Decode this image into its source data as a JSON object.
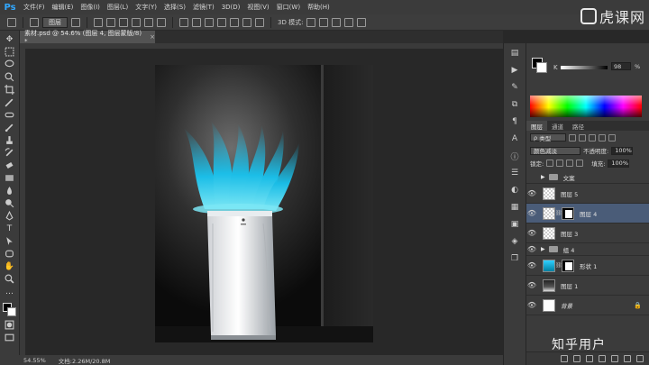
{
  "app": {
    "logo": "Ps",
    "menu": [
      "文件(F)",
      "编辑(E)",
      "图像(I)",
      "图层(L)",
      "文字(Y)",
      "选择(S)",
      "滤镜(T)",
      "3D(D)",
      "视图(V)",
      "窗口(W)",
      "帮助(H)"
    ]
  },
  "watermark_top": {
    "brand": "虎课网"
  },
  "watermark_bottom": {
    "text": "知乎用户"
  },
  "options_bar": {
    "auto_select_value": "图层",
    "mode_3d_label": "3D 模式:"
  },
  "document": {
    "tab_title": "素材.psd @ 54.6% (图层 4, 图层蒙版/8) *",
    "close_glyph": "×"
  },
  "status_bar": {
    "zoom": "54.55%",
    "doc_size": "文档:2.26M/20.8M"
  },
  "color_panel": {
    "channel_label": "K",
    "k_value": "98",
    "k_unit": "%"
  },
  "layers_panel": {
    "tabs": [
      "图层",
      "通道",
      "路径"
    ],
    "filter_kind": "类型",
    "blend_mode": "颜色减淡",
    "opacity_label": "不透明度:",
    "opacity_value": "100%",
    "lock_label": "锁定:",
    "fill_label": "填充:",
    "fill_value": "100%",
    "layers": [
      {
        "name": "文案",
        "kind": "group",
        "visible": false
      },
      {
        "name": "图层 5",
        "kind": "pixel",
        "visible": true
      },
      {
        "name": "图层 4",
        "kind": "masked",
        "visible": true,
        "selected": true
      },
      {
        "name": "图层 3",
        "kind": "pixel",
        "visible": true
      },
      {
        "name": "组 4",
        "kind": "group",
        "visible": true
      },
      {
        "name": "形状 1",
        "kind": "shape",
        "visible": true
      },
      {
        "name": "图层 1",
        "kind": "photo",
        "visible": true
      },
      {
        "name": "背景",
        "kind": "background",
        "visible": true,
        "locked": true
      }
    ]
  },
  "colors": {
    "accent_blue": "#31a8ff",
    "glow_cyan": "#33d6ff",
    "selected_layer": "#4a5c78",
    "panel_bg": "#3b3b3b",
    "canvas_bg": "#282828"
  },
  "icons": {
    "eye": "eye-icon",
    "lock": "lock-icon",
    "chain": "link-icon",
    "folder": "folder-icon"
  }
}
